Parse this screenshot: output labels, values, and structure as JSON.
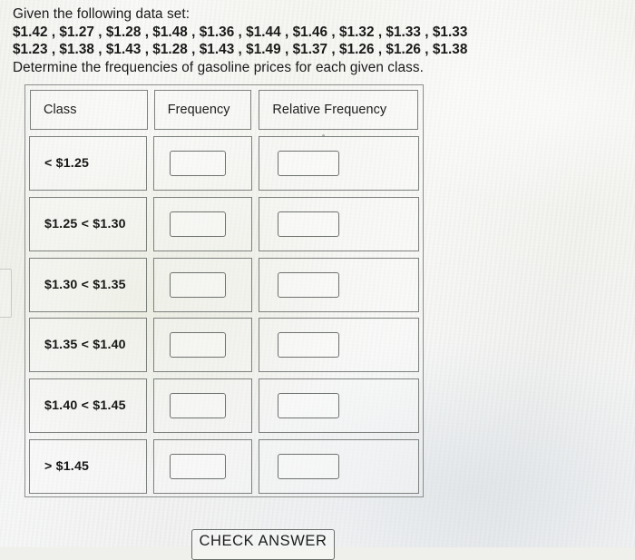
{
  "problem": {
    "intro": "Given the following data set:",
    "data_line_1": "$1.42 , $1.27 , $1.28 , $1.48 , $1.36 , $1.44 , $1.46 , $1.32 , $1.33 , $1.33",
    "data_line_2": "$1.23 , $1.38 , $1.43 , $1.28 , $1.43 , $1.49 , $1.37 , $1.26 , $1.26 , $1.38",
    "instruction": "Determine the frequencies of gasoline prices for each given class.",
    "data_values": [
      "$1.42",
      "$1.27",
      "$1.28",
      "$1.48",
      "$1.36",
      "$1.44",
      "$1.46",
      "$1.32",
      "$1.33",
      "$1.33",
      "$1.23",
      "$1.38",
      "$1.43",
      "$1.28",
      "$1.43",
      "$1.49",
      "$1.37",
      "$1.26",
      "$1.26",
      "$1.38"
    ]
  },
  "table": {
    "headers": {
      "class": "Class",
      "frequency": "Frequency",
      "relative_frequency": "Relative Frequency"
    },
    "rows": [
      {
        "class": "< $1.25",
        "frequency": "",
        "relative_frequency": ""
      },
      {
        "class": "$1.25 < $1.30",
        "frequency": "",
        "relative_frequency": ""
      },
      {
        "class": "$1.30 < $1.35",
        "frequency": "",
        "relative_frequency": ""
      },
      {
        "class": "$1.35 < $1.40",
        "frequency": "",
        "relative_frequency": ""
      },
      {
        "class": "$1.40 < $1.45",
        "frequency": "",
        "relative_frequency": ""
      },
      {
        "class": "> $1.45",
        "frequency": "",
        "relative_frequency": ""
      }
    ]
  },
  "actions": {
    "check_answer_label": "CHECK ANSWER"
  },
  "colors": {
    "page_background": "#efefeb",
    "text": "#1a1a1a",
    "table_border": "#7d817e",
    "input_border": "#6e726f"
  }
}
